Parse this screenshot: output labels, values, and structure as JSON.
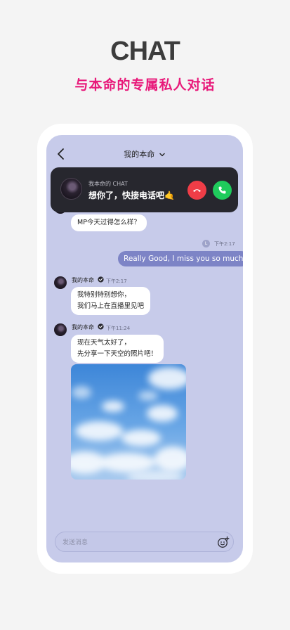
{
  "hero": {
    "title": "CHAT",
    "subtitle": "与本命的专属私人对话"
  },
  "nav": {
    "title": "我的本命"
  },
  "call_banner": {
    "caller_name": "我本命的 CHAT",
    "message": "想你了，快接电话吧🤙"
  },
  "messages": [
    {
      "from": "other",
      "text": "MP今天过得怎么样？"
    },
    {
      "from": "me",
      "avatar_letter": "L",
      "time": "下午2:17",
      "text": "Really Good, I miss you so much"
    },
    {
      "from": "other",
      "sender": "我的本命",
      "time": "下午2:17",
      "lines": [
        "我特别特别想你，",
        "我们马上在直播里见吧"
      ]
    },
    {
      "from": "other",
      "sender": "我的本命",
      "time": "下午11:24",
      "lines": [
        "现在天气太好了，",
        "先分享一下天空的照片吧！"
      ]
    }
  ],
  "input": {
    "placeholder": "发送消息"
  },
  "colors": {
    "accent": "#e8197a",
    "screen_bg": "#c7cbea",
    "outgoing_bubble": "#7d84c6",
    "decline": "#ef3d47",
    "accept": "#1fcb5c"
  },
  "icons": [
    "back-icon",
    "chevron-down-icon",
    "phone-decline-icon",
    "phone-accept-icon",
    "verified-icon",
    "emoji-icon"
  ]
}
